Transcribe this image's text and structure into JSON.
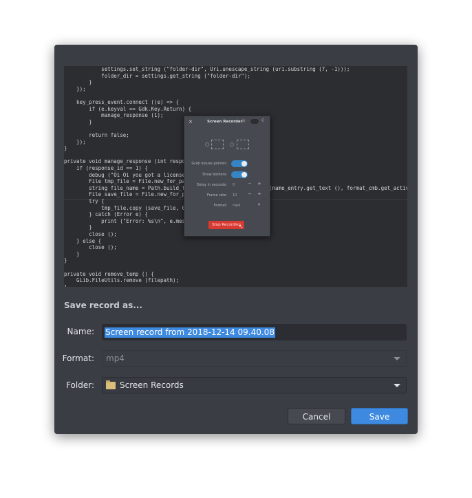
{
  "dialog": {
    "section_title": "Save record as...",
    "name_label": "Name:",
    "name_value": "Screen record from 2018-12-14 09.40.08",
    "format_label": "Format:",
    "format_value": "mp4",
    "folder_label": "Folder:",
    "folder_value": "Screen Records",
    "cancel_label": "Cancel",
    "save_label": "Save"
  },
  "recorder": {
    "title": "Screen Recorder",
    "close": "×",
    "grab_pointer_label": "Grab mouse pointer:",
    "show_borders_label": "Show borders:",
    "delay_label": "Delay in seconds:",
    "delay_value": "0",
    "framerate_label": "Frame rate:",
    "framerate_value": "10",
    "format_label": "Format:",
    "format_value": "mp4",
    "stop_label": "Stop Recording"
  },
  "code": [
    "            settings.set_string (\"folder-dir\", Uri.unescape_string (uri.substring (7, -1)));",
    "            folder_dir = settings.get_string (\"folder-dir\");",
    "        }",
    "    });",
    "",
    "    key_press_event.connect ((e) => {",
    "        if (e.keyval == Gdk.Key.Return) {",
    "            manage_response (1);",
    "        }",
    "",
    "        return false;",
    "    });",
    "}",
    "",
    "private void manage_response (int respo",
    "    if (response_id == 1) {",
    "        debug (\"Oi Oi you got a license",
    "        File tmp_file = File.new_for_pa",
    "        string file_name = Path.build_f                     rintf (name_entry.get_text (), format_cmb.get_active_",
    "        File save_file = File.new_for_p",
    "        try {",
    "            tmp_file.copy (save_file, 0",
    "        } catch (Error e) {",
    "            print (\"Error: %s\\n\", e.mes",
    "        }",
    "        close ();",
    "    } else {",
    "        close ();",
    "    }",
    "}",
    "",
    "private void remove_temp () {",
    "    GLib.FileUtils.remove (filepath);",
    "}"
  ],
  "colors": {
    "accent": "#3d8ae0",
    "stop_button": "#d83a32",
    "dialog_bg": "#3a3d44"
  },
  "icons": [
    "close-icon",
    "gear-icon",
    "moon-icon",
    "folder-icon",
    "chevron-down-icon"
  ]
}
